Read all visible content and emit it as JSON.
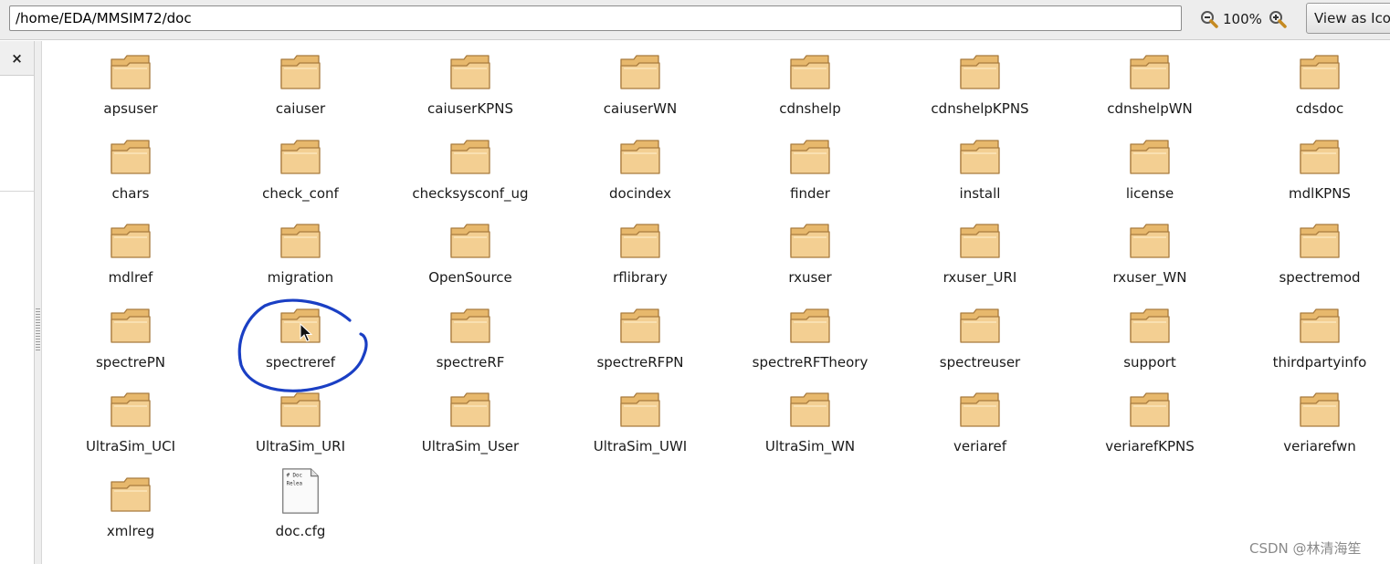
{
  "toolbar": {
    "location": "/home/EDA/MMSIM72/doc",
    "zoom_level": "100%",
    "view_button_label": "View as Icons"
  },
  "sidebar": {
    "close_label": "×"
  },
  "items": [
    {
      "label": "apsuser",
      "type": "folder"
    },
    {
      "label": "caiuser",
      "type": "folder"
    },
    {
      "label": "caiuserKPNS",
      "type": "folder"
    },
    {
      "label": "caiuserWN",
      "type": "folder"
    },
    {
      "label": "cdnshelp",
      "type": "folder"
    },
    {
      "label": "cdnshelpKPNS",
      "type": "folder"
    },
    {
      "label": "cdnshelpWN",
      "type": "folder"
    },
    {
      "label": "cdsdoc",
      "type": "folder"
    },
    {
      "label": "chars",
      "type": "folder"
    },
    {
      "label": "check_conf",
      "type": "folder"
    },
    {
      "label": "checksysconf_ug",
      "type": "folder"
    },
    {
      "label": "docindex",
      "type": "folder"
    },
    {
      "label": "finder",
      "type": "folder"
    },
    {
      "label": "install",
      "type": "folder"
    },
    {
      "label": "license",
      "type": "folder"
    },
    {
      "label": "mdlKPNS",
      "type": "folder"
    },
    {
      "label": "mdlref",
      "type": "folder"
    },
    {
      "label": "migration",
      "type": "folder"
    },
    {
      "label": "OpenSource",
      "type": "folder"
    },
    {
      "label": "rflibrary",
      "type": "folder"
    },
    {
      "label": "rxuser",
      "type": "folder"
    },
    {
      "label": "rxuser_URI",
      "type": "folder"
    },
    {
      "label": "rxuser_WN",
      "type": "folder"
    },
    {
      "label": "spectremod",
      "type": "folder"
    },
    {
      "label": "spectrePN",
      "type": "folder"
    },
    {
      "label": "spectreref",
      "type": "folder",
      "highlighted": true
    },
    {
      "label": "spectreRF",
      "type": "folder"
    },
    {
      "label": "spectreRFPN",
      "type": "folder"
    },
    {
      "label": "spectreRFTheory",
      "type": "folder"
    },
    {
      "label": "spectreuser",
      "type": "folder"
    },
    {
      "label": "support",
      "type": "folder"
    },
    {
      "label": "thirdpartyinfo",
      "type": "folder"
    },
    {
      "label": "UltraSim_UCI",
      "type": "folder"
    },
    {
      "label": "UltraSim_URI",
      "type": "folder"
    },
    {
      "label": "UltraSim_User",
      "type": "folder"
    },
    {
      "label": "UltraSim_UWI",
      "type": "folder"
    },
    {
      "label": "UltraSim_WN",
      "type": "folder"
    },
    {
      "label": "veriaref",
      "type": "folder"
    },
    {
      "label": "veriarefKPNS",
      "type": "folder"
    },
    {
      "label": "veriarefwn",
      "type": "folder"
    },
    {
      "label": "xmlreg",
      "type": "folder"
    },
    {
      "label": "doc.cfg",
      "type": "file",
      "preview_lines": [
        "# Doc",
        "Relea"
      ]
    }
  ],
  "watermark": "CSDN @林清海笙",
  "colors": {
    "folder_fill": "#f3cf92",
    "folder_stroke": "#a87b3e",
    "annotation_stroke": "#1a3fc4"
  }
}
